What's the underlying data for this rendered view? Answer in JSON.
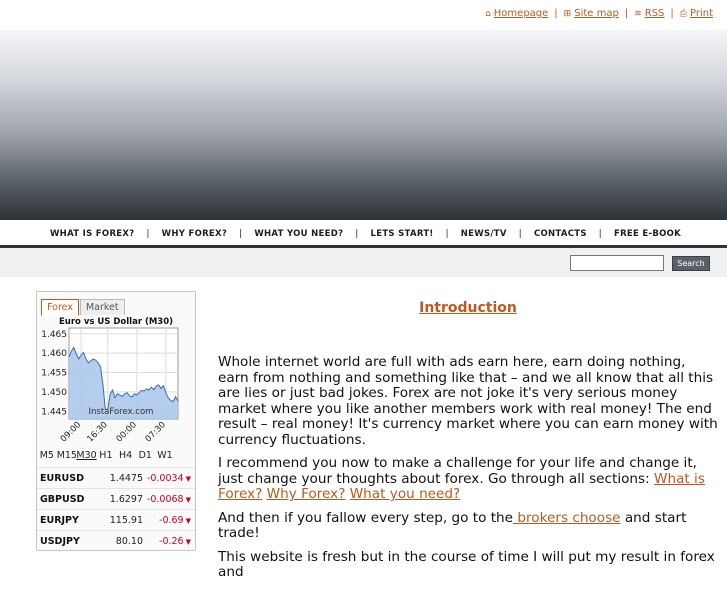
{
  "toplinks": {
    "homepage": "Homepage",
    "sitemap": "Site map",
    "rss": "RSS",
    "print": "Print",
    "separator": "|"
  },
  "nav": {
    "items": [
      "WHAT IS FOREX?",
      "WHY FOREX?",
      "WHAT YOU NEED?",
      "LETS START!",
      "NEWS/TV",
      "CONTACTS",
      "FREE E-BOOK"
    ],
    "separator": "|"
  },
  "search": {
    "value": "",
    "button_label": "Search"
  },
  "widget": {
    "tabs": [
      "Forex",
      "Market"
    ],
    "active_tab": "Forex",
    "timeframes": [
      "M5",
      "M15",
      "M30",
      "H1",
      "H4",
      "D1",
      "W1"
    ],
    "selected_timeframe": "M30",
    "quotes": [
      {
        "symbol": "EURUSD",
        "price": "1.4475",
        "change": "-0.0034"
      },
      {
        "symbol": "GBPUSD",
        "price": "1.6297",
        "change": "-0.0068"
      },
      {
        "symbol": "EURJPY",
        "price": "115.91",
        "change": "-0.69"
      },
      {
        "symbol": "USDJPY",
        "price": "80.10",
        "change": "-0.26"
      }
    ],
    "colors": {
      "accent": "#c0581e",
      "negative": "#d0021b",
      "chart_fill": "#a9c6ea",
      "chart_line": "#3a6bb5"
    }
  },
  "chart_data": {
    "type": "area",
    "title": "Euro vs US Dollar (M30)",
    "watermark": "InstaForex.com",
    "x_tick_labels": [
      "09:00",
      "16:30",
      "00:00",
      "07:30"
    ],
    "y_tick_labels": [
      "1.465",
      "1.460",
      "1.455",
      "1.450",
      "1.445"
    ],
    "ylim": [
      1.443,
      1.4665
    ],
    "grid": true,
    "values": [
      1.459,
      1.4605,
      1.4615,
      1.4598,
      1.4585,
      1.4595,
      1.4602,
      1.4585,
      1.4575,
      1.458,
      1.4585,
      1.4582,
      1.4575,
      1.4565,
      1.452,
      1.4455,
      1.4455,
      1.4495,
      1.4505,
      1.4485,
      1.4495,
      1.4492,
      1.4488,
      1.4495,
      1.4498,
      1.449,
      1.4487,
      1.4495,
      1.4492,
      1.4498,
      1.4504,
      1.4502,
      1.4508,
      1.4505,
      1.4512,
      1.4506,
      1.4515,
      1.4518,
      1.4509,
      1.4516,
      1.4498,
      1.4484,
      1.4478,
      1.4475,
      1.4488,
      1.4476
    ]
  },
  "content": {
    "title": "Introduction",
    "p1": "Whole internet world are full with ads earn here, earn doing nothing, earn from nothing and something like that – and we all know that all this are lies or just bad jokes. Forex are not joke it's very serious money market where you like another members work with real money! The end result – real money! It's currency market where you can earn money with currency fluctuations.",
    "p2_text": "I recommend you now to make a challenge for your life and change it, just change your thoughts about forex. Go through all sections: ",
    "p2_link1": "What is Forex?",
    "p2_link2": "Why Forex?",
    "p2_link3": "What you need?",
    "p3_text1": "And then if you fallow every step, go to the",
    "p3_link": " brokers choose",
    "p3_text2": " and start trade!",
    "p4": "This website is fresh but in the course of time I will put my result in forex and"
  }
}
